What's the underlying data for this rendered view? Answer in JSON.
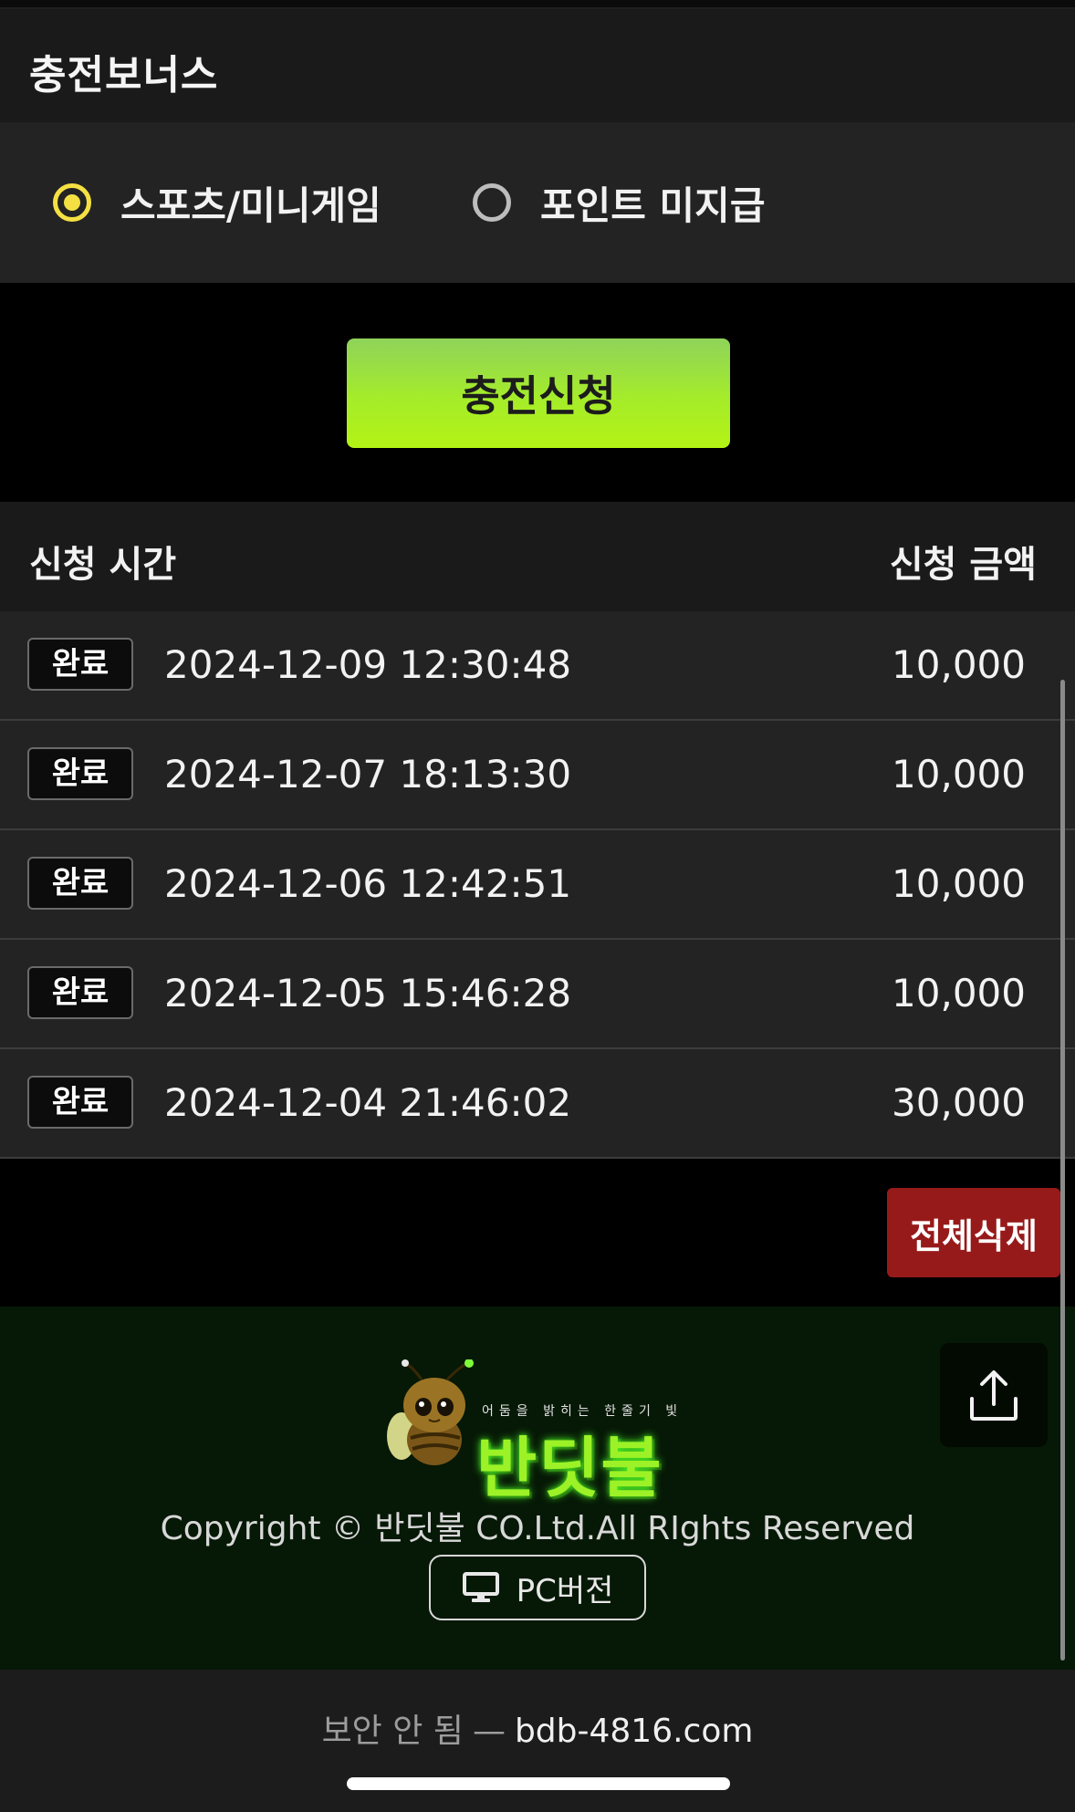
{
  "section": {
    "title": "충전보너스"
  },
  "bonus_options": [
    {
      "label": "스포츠/미니게임",
      "selected": true
    },
    {
      "label": "포인트 미지급",
      "selected": false
    }
  ],
  "apply_button": "충전신청",
  "list": {
    "col_time": "신청 시간",
    "col_amount": "신청 금액",
    "rows": [
      {
        "status": "완료",
        "datetime": "2024-12-09 12:30:48",
        "amount": "10,000"
      },
      {
        "status": "완료",
        "datetime": "2024-12-07 18:13:30",
        "amount": "10,000"
      },
      {
        "status": "완료",
        "datetime": "2024-12-06 12:42:51",
        "amount": "10,000"
      },
      {
        "status": "완료",
        "datetime": "2024-12-05 15:46:28",
        "amount": "10,000"
      },
      {
        "status": "완료",
        "datetime": "2024-12-04 21:46:02",
        "amount": "30,000"
      }
    ]
  },
  "delete_all_button": "전체삭제",
  "footer": {
    "logo_tagline": "어둠을 밝히는 한줄기 빛",
    "logo_brand": "반딧불",
    "copyright": "Copyright © 반딧불 CO.Ltd.All RIghts Reserved",
    "pc_button": "PC버전",
    "upload_icon": "share-upload-icon",
    "monitor_icon": "monitor-icon"
  },
  "browser": {
    "security_label": "보안 안 됨",
    "separator": "—",
    "host": "bdb-4816.com"
  },
  "colors": {
    "accent_yellow": "#f4e043",
    "apply_green": "#a5ec2a",
    "delete_red": "#971a1a",
    "footer_bg": "#061806"
  }
}
